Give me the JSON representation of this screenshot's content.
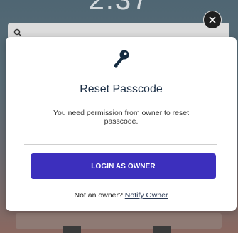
{
  "background": {
    "time": "2:37"
  },
  "dialog": {
    "title": "Reset Passcode",
    "message": "You need permission from owner to reset passcode.",
    "login_button_label": "LOGIN AS OWNER",
    "footer_question": "Not an owner?",
    "notify_link_label": "Notify Owner"
  },
  "icons": {
    "key": "key-icon",
    "close": "close-icon",
    "search": "search-icon"
  },
  "colors": {
    "accent": "#3c2fbd",
    "title": "#1d3047",
    "close_bg": "#1f1f1f"
  }
}
